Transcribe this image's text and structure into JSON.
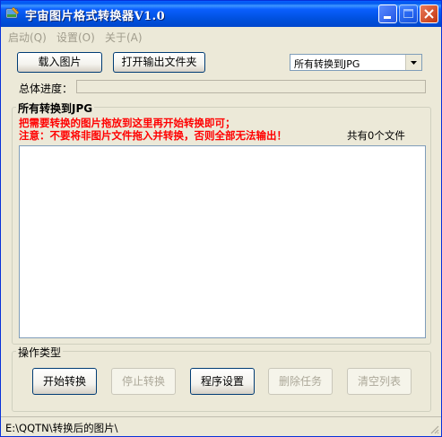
{
  "window": {
    "title": "宇宙图片格式转换器V1.0"
  },
  "menu": [
    {
      "label": "启动(Q)"
    },
    {
      "label": "设置(O)"
    },
    {
      "label": "关于(A)"
    }
  ],
  "toolbar": {
    "load_label": "载入图片",
    "open_output_label": "打开输出文件夹",
    "convert_select_value": "所有转换到JPG"
  },
  "progress": {
    "label": "总体进度：",
    "fraction": 0
  },
  "file_group": {
    "title": "所有转换到JPG",
    "hint_line1": "把需要转换的图片拖放到这里再开始转换即可；",
    "hint_line2": "注意：不要将非图片文件拖入并转换，否则全部无法输出！",
    "count_text": "共有0个文件"
  },
  "ops_group": {
    "title": "操作类型",
    "start_label": "开始转换",
    "stop_label": "停止转换",
    "settings_label": "程序设置",
    "delete_label": "删除任务",
    "clear_label": "清空列表"
  },
  "status": {
    "path": "E:\\QQTN\\转换后的图片\\"
  },
  "colors": {
    "title_blue": "#0A5FFF",
    "warning_red": "#FF0000",
    "face": "#ECE9D8"
  }
}
